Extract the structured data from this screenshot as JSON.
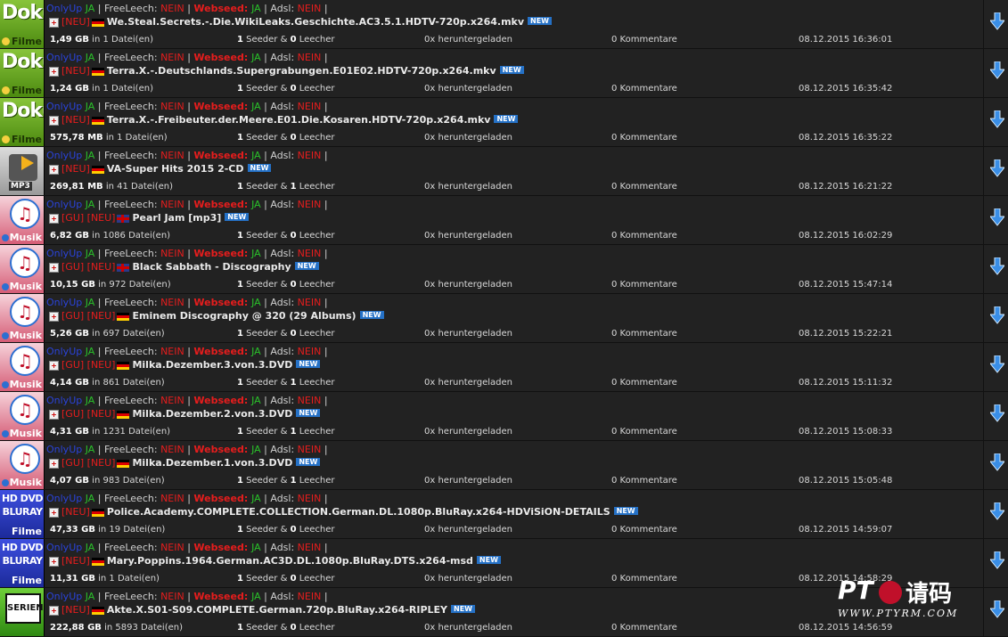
{
  "labels": {
    "only_up": "OnlyUp",
    "freeleech": "FreeLeech:",
    "webseed": "Webseed:",
    "adsl": "Adsl:",
    "ja": "JA",
    "nein": "NEIN",
    "sep": "|",
    "new_badge": "NEW",
    "in": "in",
    "files_suffix": "Datei(en)",
    "seeder": "Seeder &",
    "leecher": "Leecher",
    "downloaded": "heruntergeladen",
    "comments": "Kommentare"
  },
  "category_labels": {
    "doku_big": "Doku",
    "doku_sub": "Filme",
    "mp3": "MP3",
    "musik_sub": "Musik",
    "hddvd_l1": "HD DVD",
    "hddvd_l2": "BLURAY",
    "hddvd_sub": "Filme",
    "serien": "SERIEN"
  },
  "colors": {
    "only_up": "#2a43d9",
    "ja": "#2ac12a",
    "nein": "#e61d1d",
    "new_badge": "#2571c6",
    "row_bg": "#222222",
    "download_arrow": "#3a8ee6"
  },
  "torrents": [
    {
      "category": "doku",
      "freeleech": "NEIN",
      "webseed": "JA",
      "adsl": "NEIN",
      "tags": "[NEU]",
      "flag": "de",
      "name": "We.Steal.Secrets.-.Die.WikiLeaks.Geschichte.AC3.5.1.HDTV-720p.x264.mkv",
      "size": "1,49 GB",
      "files": "1",
      "seeders": "1",
      "leechers": "0",
      "downloads": "0x",
      "comments": "0",
      "date": "08.12.2015 16:36:01"
    },
    {
      "category": "doku",
      "freeleech": "NEIN",
      "webseed": "JA",
      "adsl": "NEIN",
      "tags": "[NEU]",
      "flag": "de",
      "name": "Terra.X.-.Deutschlands.Supergrabungen.E01E02.HDTV-720p.x264.mkv",
      "size": "1,24 GB",
      "files": "1",
      "seeders": "1",
      "leechers": "0",
      "downloads": "0x",
      "comments": "0",
      "date": "08.12.2015 16:35:42"
    },
    {
      "category": "doku",
      "freeleech": "NEIN",
      "webseed": "JA",
      "adsl": "NEIN",
      "tags": "[NEU]",
      "flag": "de",
      "name": "Terra.X.-.Freibeuter.der.Meere.E01.Die.Kosaren.HDTV-720p.x264.mkv",
      "size": "575,78 MB",
      "files": "1",
      "seeders": "1",
      "leechers": "0",
      "downloads": "0x",
      "comments": "0",
      "date": "08.12.2015 16:35:22"
    },
    {
      "category": "mp3",
      "freeleech": "NEIN",
      "webseed": "JA",
      "adsl": "NEIN",
      "tags": "[NEU]",
      "flag": "de",
      "name": "VA-Super Hits 2015 2-CD",
      "size": "269,81 MB",
      "files": "41",
      "seeders": "1",
      "leechers": "1",
      "downloads": "0x",
      "comments": "0",
      "date": "08.12.2015 16:21:22"
    },
    {
      "category": "musik",
      "freeleech": "NEIN",
      "webseed": "JA",
      "adsl": "NEIN",
      "tags": "[GU] [NEU]",
      "flag": "gb",
      "name": "Pearl Jam [mp3]",
      "size": "6,82 GB",
      "files": "1086",
      "seeders": "1",
      "leechers": "0",
      "downloads": "0x",
      "comments": "0",
      "date": "08.12.2015 16:02:29"
    },
    {
      "category": "musik",
      "freeleech": "NEIN",
      "webseed": "JA",
      "adsl": "NEIN",
      "tags": "[GU] [NEU]",
      "flag": "gb",
      "name": "Black Sabbath - Discography",
      "size": "10,15 GB",
      "files": "972",
      "seeders": "1",
      "leechers": "0",
      "downloads": "0x",
      "comments": "0",
      "date": "08.12.2015 15:47:14"
    },
    {
      "category": "musik",
      "freeleech": "NEIN",
      "webseed": "JA",
      "adsl": "NEIN",
      "tags": "[GU] [NEU]",
      "flag": "de",
      "name": "Eminem Discography @ 320 (29 Albums)",
      "size": "5,26 GB",
      "files": "697",
      "seeders": "1",
      "leechers": "0",
      "downloads": "0x",
      "comments": "0",
      "date": "08.12.2015 15:22:21"
    },
    {
      "category": "musik",
      "freeleech": "NEIN",
      "webseed": "JA",
      "adsl": "NEIN",
      "tags": "[GU] [NEU]",
      "flag": "de",
      "name": "Milka.Dezember.3.von.3.DVD",
      "size": "4,14 GB",
      "files": "861",
      "seeders": "1",
      "leechers": "1",
      "downloads": "0x",
      "comments": "0",
      "date": "08.12.2015 15:11:32"
    },
    {
      "category": "musik",
      "freeleech": "NEIN",
      "webseed": "JA",
      "adsl": "NEIN",
      "tags": "[GU] [NEU]",
      "flag": "de",
      "name": "Milka.Dezember.2.von.3.DVD",
      "size": "4,31 GB",
      "files": "1231",
      "seeders": "1",
      "leechers": "1",
      "downloads": "0x",
      "comments": "0",
      "date": "08.12.2015 15:08:33"
    },
    {
      "category": "musik",
      "freeleech": "NEIN",
      "webseed": "JA",
      "adsl": "NEIN",
      "tags": "[GU] [NEU]",
      "flag": "de",
      "name": "Milka.Dezember.1.von.3.DVD",
      "size": "4,07 GB",
      "files": "983",
      "seeders": "1",
      "leechers": "1",
      "downloads": "0x",
      "comments": "0",
      "date": "08.12.2015 15:05:48"
    },
    {
      "category": "hddvd",
      "freeleech": "NEIN",
      "webseed": "JA",
      "adsl": "NEIN",
      "tags": "[NEU]",
      "flag": "de",
      "name": "Police.Academy.COMPLETE.COLLECTION.German.DL.1080p.BluRay.x264-HDViSiON-DETAILS",
      "size": "47,33 GB",
      "files": "19",
      "seeders": "1",
      "leechers": "0",
      "downloads": "0x",
      "comments": "0",
      "date": "08.12.2015 14:59:07"
    },
    {
      "category": "hddvd",
      "freeleech": "NEIN",
      "webseed": "JA",
      "adsl": "NEIN",
      "tags": "[NEU]",
      "flag": "de",
      "name": "Mary.Poppins.1964.German.AC3D.DL.1080p.BluRay.DTS.x264-msd",
      "size": "11,31 GB",
      "files": "1",
      "seeders": "1",
      "leechers": "0",
      "downloads": "0x",
      "comments": "0",
      "date": "08.12.2015 14:58:29"
    },
    {
      "category": "serien",
      "freeleech": "NEIN",
      "webseed": "JA",
      "adsl": "NEIN",
      "tags": "[NEU]",
      "flag": "de",
      "name": "Akte.X.S01-S09.COMPLETE.German.720p.BluRay.x264-RIPLEY",
      "size": "222,88 GB",
      "files": "5893",
      "seeders": "1",
      "leechers": "0",
      "downloads": "0x",
      "comments": "0",
      "date": "08.12.2015 14:56:59"
    }
  ],
  "watermark": {
    "brand": "PT",
    "chinese": "请码",
    "url": "WWW.PTYRM.COM"
  }
}
